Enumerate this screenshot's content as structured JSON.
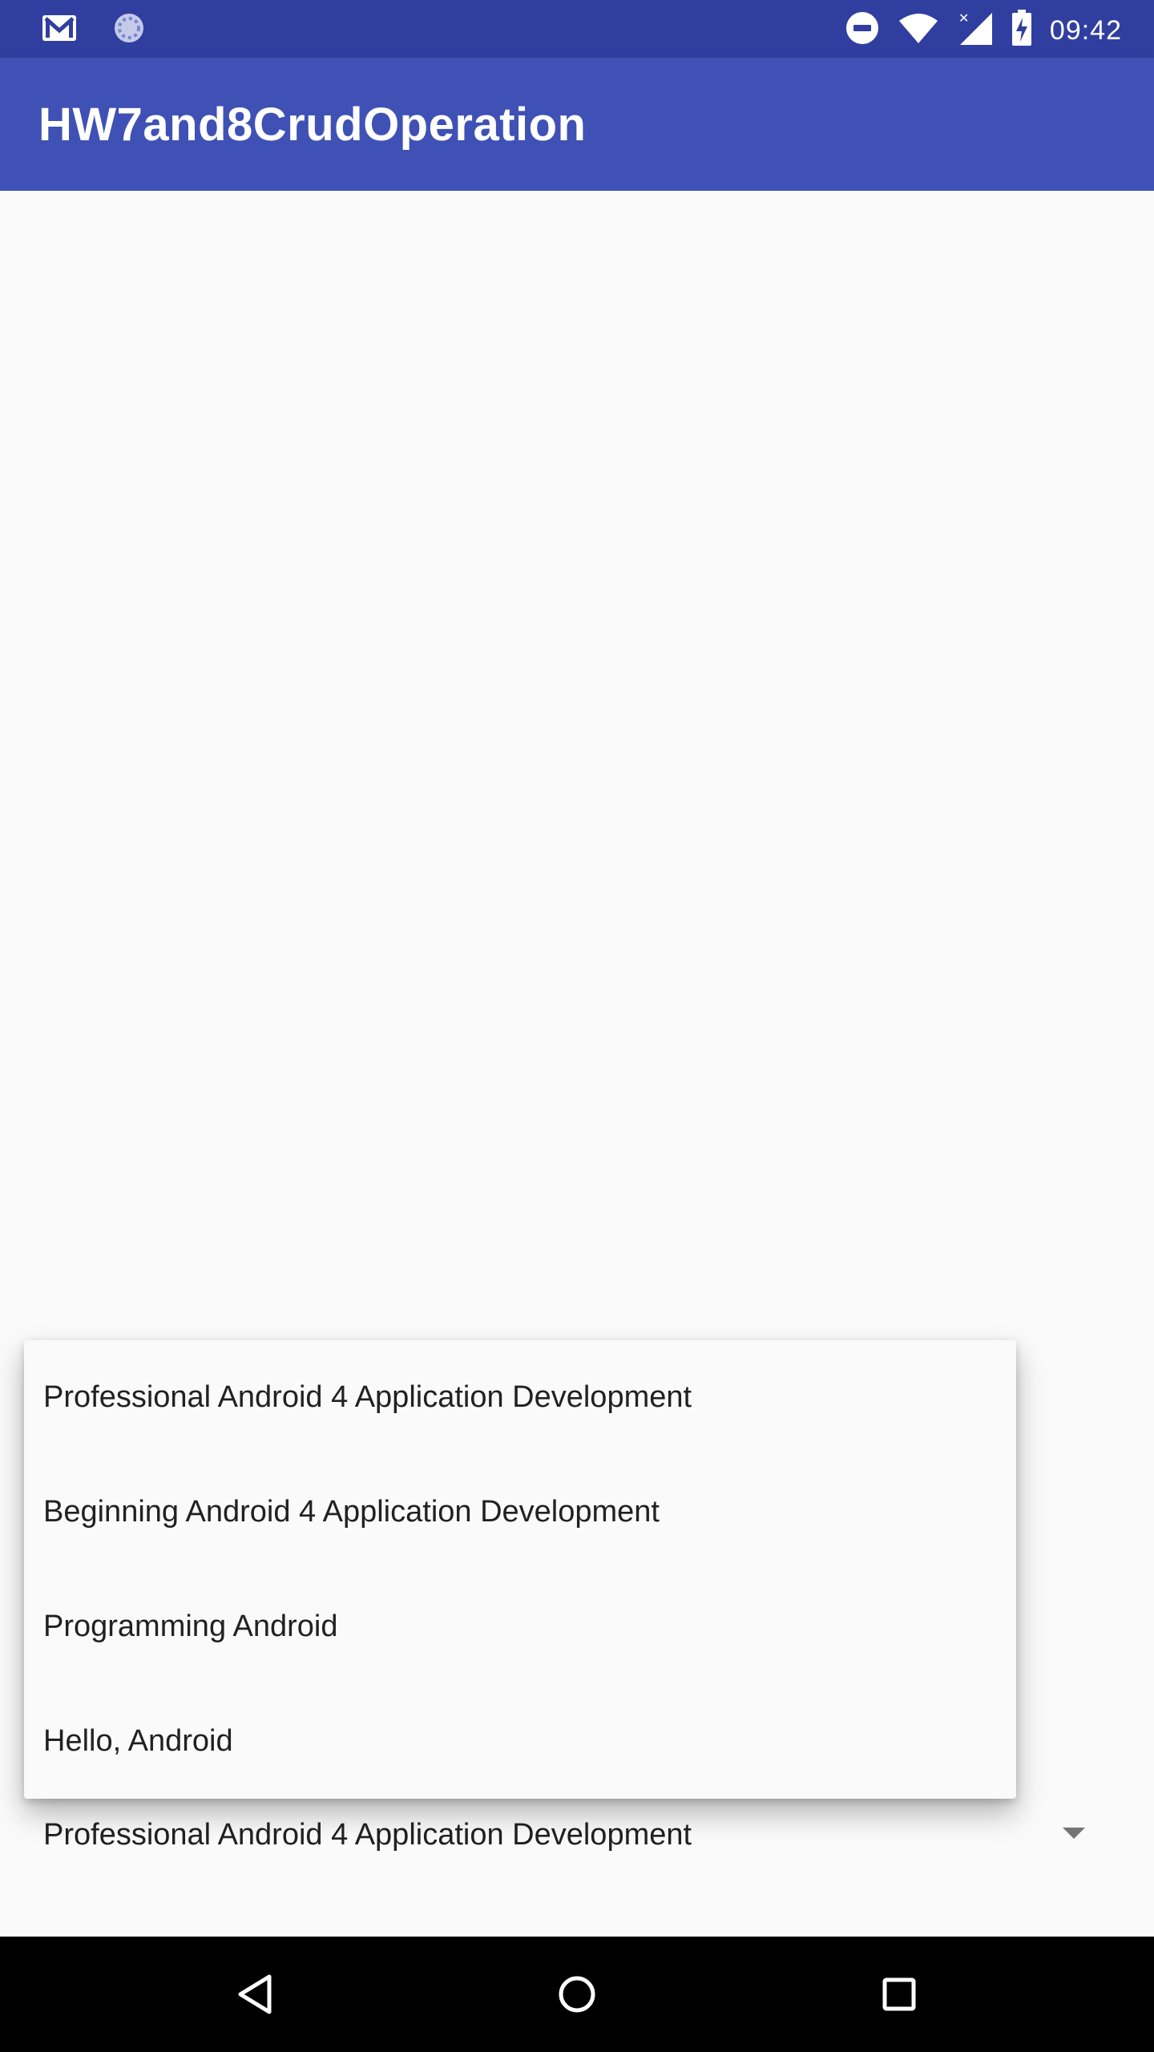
{
  "status_bar": {
    "time": "09:42",
    "icons": [
      "gmail-icon",
      "sync-icon",
      "do-not-disturb-icon",
      "wifi-icon",
      "signal-no-data-icon",
      "battery-charging-icon"
    ]
  },
  "app_bar": {
    "title": "HW7and8CrudOperation"
  },
  "spinner": {
    "selected": "Professional Android 4 Application Development",
    "arrow_icon": "dropdown-arrow-icon"
  },
  "dropdown": {
    "items": [
      "Professional Android 4 Application Development",
      "Beginning Android 4 Application Development",
      "Programming Android",
      "Hello, Android"
    ]
  },
  "nav_bar": {
    "icons": [
      "back-icon",
      "home-icon",
      "recents-icon"
    ]
  },
  "colors": {
    "status_bar": "#303f9f",
    "app_bar": "#3f51b5",
    "background": "#fafafa",
    "nav_bar": "#000000"
  }
}
